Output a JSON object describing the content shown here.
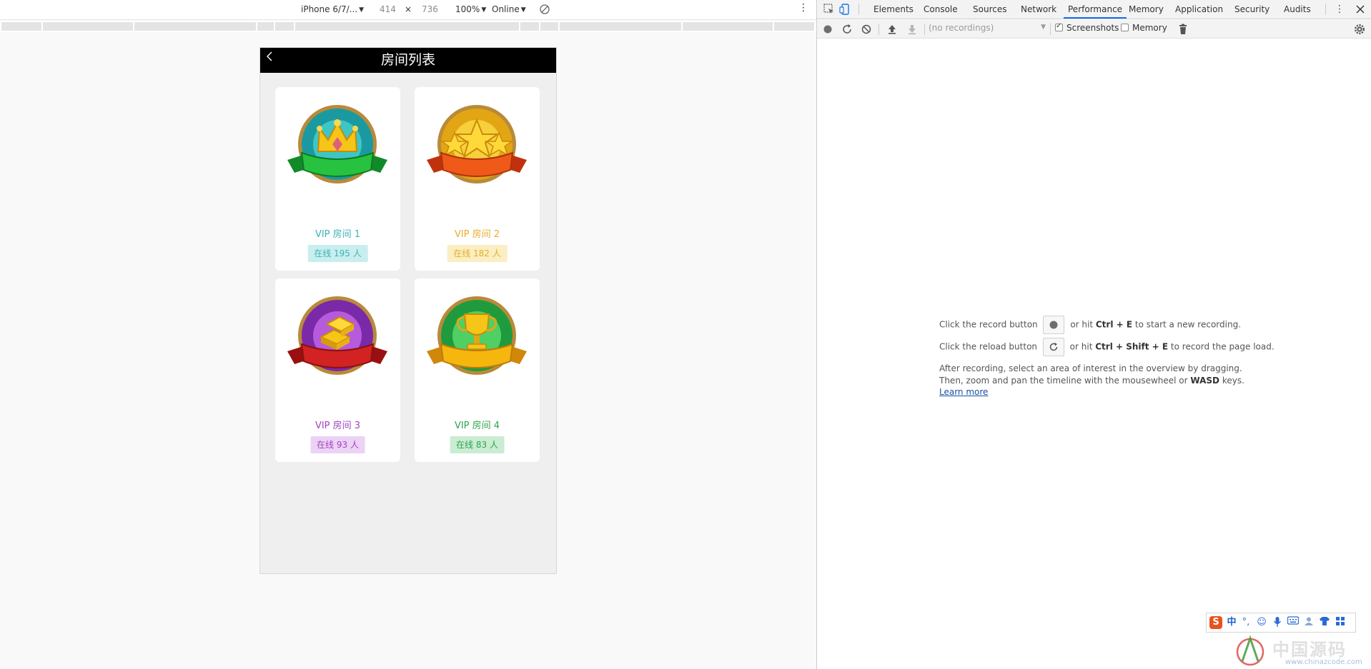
{
  "device_toolbar": {
    "device": "iPhone 6/7/...",
    "width": "414",
    "times": "×",
    "height": "736",
    "zoom": "100%",
    "network": "Online"
  },
  "app": {
    "title": "房间列表",
    "rooms": [
      {
        "name": "VIP 房间 1",
        "online": "在线 195 人",
        "accent": "#3cb2b8",
        "badge_bg": "#c9eeee",
        "icon": "crown-medal-icon"
      },
      {
        "name": "VIP 房间 2",
        "online": "在线 182 人",
        "accent": "#e6ac2a",
        "badge_bg": "#fbeec2",
        "icon": "stars-medal-icon"
      },
      {
        "name": "VIP 房间 3",
        "online": "在线 93 人",
        "accent": "#a044c0",
        "badge_bg": "#ecd2f4",
        "icon": "gold-bars-medal-icon"
      },
      {
        "name": "VIP 房间 4",
        "online": "在线 83 人",
        "accent": "#2ea44f",
        "badge_bg": "#c9ecd2",
        "icon": "trophy-medal-icon"
      }
    ]
  },
  "devtools": {
    "tabs": [
      "Elements",
      "Console",
      "Sources",
      "Network",
      "Performance",
      "Memory",
      "Application",
      "Security",
      "Audits"
    ],
    "active_tab": "Performance",
    "accent": "#1a73e8",
    "recordings_placeholder": "(no recordings)",
    "screenshots_label": "Screenshots",
    "screenshots_checked": true,
    "memory_label": "Memory",
    "memory_checked": false,
    "landing": {
      "record_prefix": "Click the record button",
      "record_mid": "or hit",
      "record_keys": "Ctrl + E",
      "record_suffix": "to start a new recording.",
      "reload_prefix": "Click the reload button",
      "reload_mid": "or hit",
      "reload_keys": "Ctrl + Shift + E",
      "reload_suffix": "to record the page load.",
      "after_line1": "After recording, select an area of interest in the overview by dragging.",
      "after_line2_a": "Then, zoom and pan the timeline with the mousewheel or",
      "after_line2_keys": "WASD",
      "after_line2_b": "keys.",
      "learn_more": "Learn more"
    }
  },
  "ime": {
    "icons": [
      "sogou-logo-icon",
      "chinese-mode-icon",
      "punctuation-icon",
      "emoji-icon",
      "microphone-icon",
      "keyboard-icon",
      "user-icon",
      "skin-icon",
      "grid-icon"
    ],
    "mode_label": "中",
    "punct_label": "°,"
  },
  "watermark": {
    "text": "中国源码",
    "url": "www.chinazcode.com"
  }
}
